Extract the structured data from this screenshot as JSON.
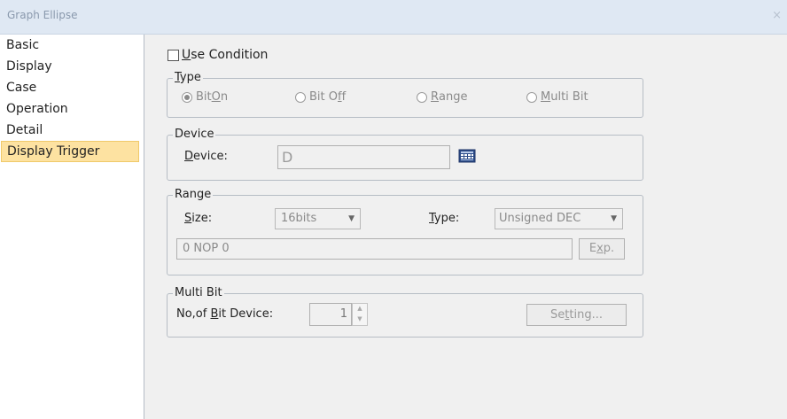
{
  "window": {
    "title": "Graph Ellipse",
    "close_glyph": "×"
  },
  "sidebar": {
    "items": [
      {
        "label": "Basic"
      },
      {
        "label": "Display"
      },
      {
        "label": "Case"
      },
      {
        "label": "Operation"
      },
      {
        "label": "Detail"
      },
      {
        "label": "Display Trigger",
        "selected": true
      }
    ]
  },
  "use_condition": {
    "label_u": "U",
    "label_rest": "se Condition",
    "checked": false
  },
  "type_group": {
    "label_u": "T",
    "label_rest": "ype",
    "options": [
      {
        "pre": "Bit ",
        "u": "O",
        "post": "n",
        "selected": true
      },
      {
        "pre": "Bit O",
        "u": "f",
        "post": "f",
        "selected": false
      },
      {
        "pre": "",
        "u": "R",
        "post": "ange",
        "selected": false
      },
      {
        "pre": "",
        "u": "M",
        "post": "ulti Bit",
        "selected": false
      }
    ]
  },
  "device_group": {
    "label": "Device",
    "field_label_u": "D",
    "field_label_rest": "evice:",
    "value": "D"
  },
  "range_group": {
    "label": "Range",
    "size_label_u": "S",
    "size_label_rest": "ize:",
    "size_value": "16bits",
    "type_label_u": "T",
    "type_label_rest": "ype:",
    "type_value": "Unsigned DEC",
    "expression": "0 NOP 0",
    "exp_pre": "E",
    "exp_u": "x",
    "exp_post": "p."
  },
  "multibit_group": {
    "label": "Multi Bit",
    "count_pre": "No,of ",
    "count_u": "B",
    "count_post": "it Device:",
    "count_value": "1",
    "setting_pre": "Se",
    "setting_u": "t",
    "setting_post": "ting..."
  },
  "colors": {
    "selected_bg": "#fde2a1",
    "titlebar_bg": "#dfe8f3"
  }
}
